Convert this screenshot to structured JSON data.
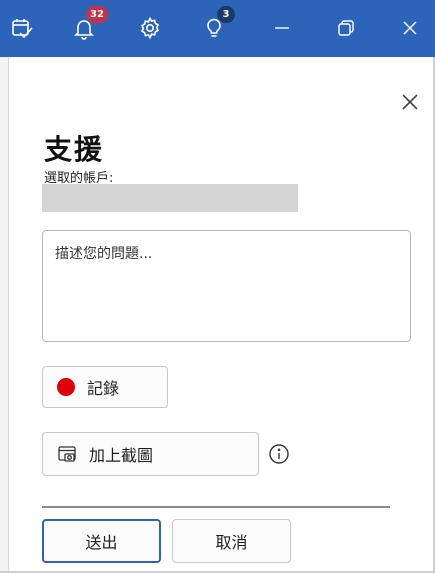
{
  "titlebar": {
    "bg_color": "#2b64b8",
    "icons": [
      {
        "name": "calendar-check-icon"
      },
      {
        "name": "bell-icon",
        "badge": "32",
        "badge_color": "#c4314b"
      },
      {
        "name": "gear-icon"
      },
      {
        "name": "lightbulb-icon",
        "badge": "3",
        "badge_color": "#1b3a66"
      },
      {
        "name": "minimize-icon"
      },
      {
        "name": "restore-icon"
      },
      {
        "name": "close-icon"
      }
    ]
  },
  "panel": {
    "title": "支援",
    "account_label": "選取的帳戶:",
    "description_placeholder": "描述您的問題...",
    "record_label": "記錄",
    "record_dot_color": "#e0000a",
    "screenshot_label": "加上截圖",
    "send_label": "送出",
    "cancel_label": "取消"
  }
}
